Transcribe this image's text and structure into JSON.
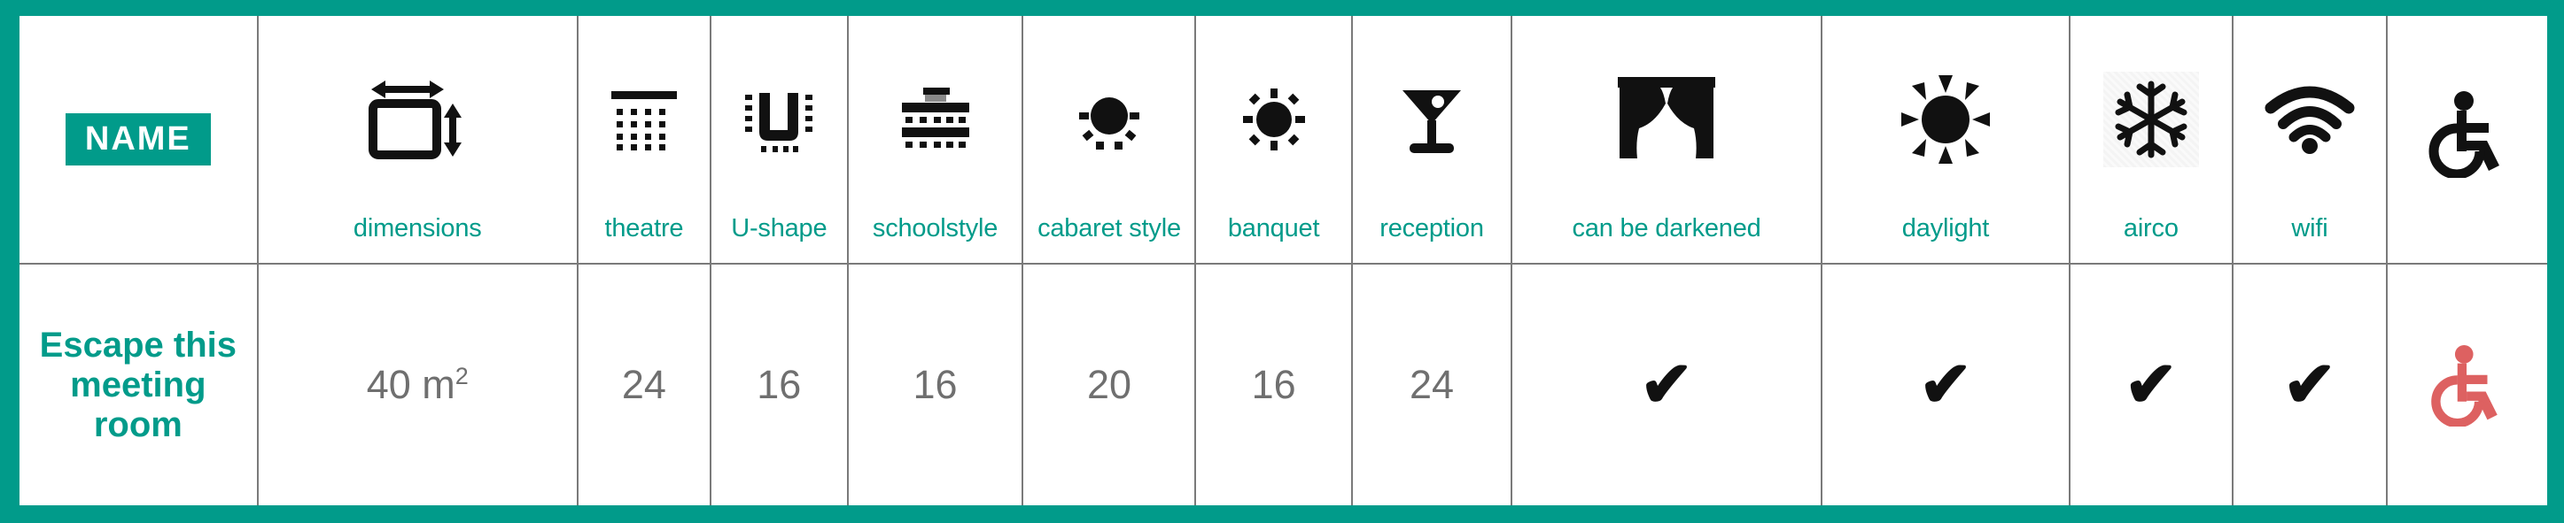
{
  "theme": {
    "accent": "#019B8A",
    "grid_line": "#7a7a7a",
    "value_text": "#6f6f6f",
    "icon_black": "#111111",
    "wheelchair_red": "#DD6161"
  },
  "table": {
    "name_badge": "NAME",
    "columns": [
      {
        "key": "name",
        "icon": "name-badge-icon",
        "label": ""
      },
      {
        "key": "dimensions",
        "icon": "dimensions-icon",
        "label": "dimensions"
      },
      {
        "key": "theatre",
        "icon": "theatre-layout-icon",
        "label": "theatre"
      },
      {
        "key": "u_shape",
        "icon": "u-shape-layout-icon",
        "label": "U-shape"
      },
      {
        "key": "schoolstyle",
        "icon": "schoolstyle-layout-icon",
        "label": "schoolstyle"
      },
      {
        "key": "cabaret",
        "icon": "cabaret-layout-icon",
        "label": "cabaret style"
      },
      {
        "key": "banquet",
        "icon": "banquet-layout-icon",
        "label": "banquet"
      },
      {
        "key": "reception",
        "icon": "cocktail-glass-icon",
        "label": "reception"
      },
      {
        "key": "darkened",
        "icon": "curtain-icon",
        "label": "can be darkened"
      },
      {
        "key": "daylight",
        "icon": "sun-icon",
        "label": "daylight"
      },
      {
        "key": "airco",
        "icon": "snowflake-icon",
        "label": "airco"
      },
      {
        "key": "wifi",
        "icon": "wifi-icon",
        "label": "wifi"
      },
      {
        "key": "accessibility",
        "icon": "wheelchair-icon",
        "label": ""
      }
    ],
    "rows": [
      {
        "name": "Escape this meeting room",
        "dimensions_value": "40 m",
        "dimensions_unit": "2",
        "theatre": "24",
        "u_shape": "16",
        "schoolstyle": "16",
        "cabaret": "20",
        "banquet": "16",
        "reception": "24",
        "darkened": "✔",
        "daylight": "✔",
        "airco": "✔",
        "wifi": "✔",
        "accessibility_icon": "wheelchair-icon"
      }
    ]
  }
}
